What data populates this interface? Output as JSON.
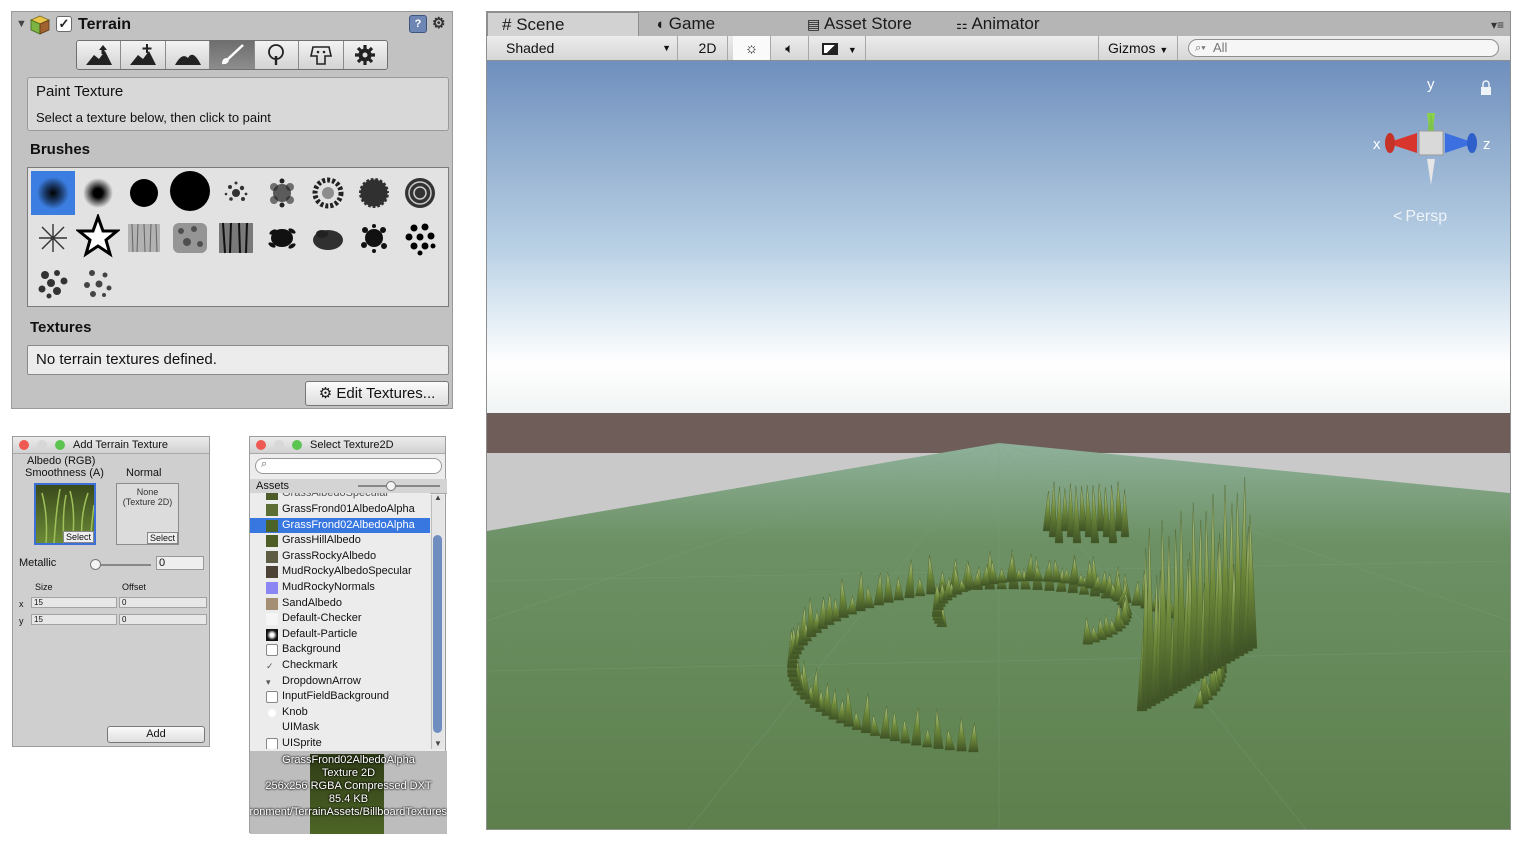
{
  "inspector": {
    "title": "Terrain",
    "enabled": true,
    "tool_icons": [
      "raise-lower-terrain-icon",
      "paint-height-icon",
      "smooth-height-icon",
      "paint-texture-icon",
      "place-trees-icon",
      "paint-details-icon",
      "terrain-settings-icon"
    ],
    "active_tool_index": 3,
    "info_title": "Paint Texture",
    "info_hint": "Select a texture below, then click to paint",
    "brushes_label": "Brushes",
    "brush_count": 20,
    "selected_brush_index": 0,
    "textures_label": "Textures",
    "textures_empty": "No terrain textures defined.",
    "edit_textures_label": "Edit Textures..."
  },
  "add_texture_window": {
    "title": "Add Terrain Texture",
    "albedo_label_1": "Albedo (RGB)",
    "albedo_label_2": "Smoothness (A)",
    "normal_label": "Normal",
    "normal_none_1": "None",
    "normal_none_2": "(Texture 2D)",
    "select_label": "Select",
    "metallic_label": "Metallic",
    "metallic_value": "0",
    "size_label": "Size",
    "offset_label": "Offset",
    "x_label": "x",
    "y_label": "y",
    "size_x": "15",
    "size_y": "15",
    "offset_x": "0",
    "offset_y": "0",
    "add_label": "Add"
  },
  "select_texture_window": {
    "title": "Select Texture2D",
    "assets_tab": "Assets",
    "clipped_item": "GrassAlbedoSpecular",
    "items": [
      {
        "name": "GrassFrond01AlbedoAlpha",
        "swatch": "#5c6e33"
      },
      {
        "name": "GrassFrond02AlbedoAlpha",
        "swatch": "#4d6226",
        "selected": true
      },
      {
        "name": "GrassHillAlbedo",
        "swatch": "#4f5e26"
      },
      {
        "name": "GrassRockyAlbedo",
        "swatch": "#5f5c44"
      },
      {
        "name": "MudRockyAlbedoSpecular",
        "swatch": "#4e4236"
      },
      {
        "name": "MudRockyNormals",
        "swatch": "#8a86f2"
      },
      {
        "name": "SandAlbedo",
        "swatch": "#a58f74"
      },
      {
        "name": "Default-Checker",
        "swatch": "#f5f5f5"
      },
      {
        "name": "Default-Particle",
        "swatch": "#111111"
      },
      {
        "name": "Background",
        "swatch": "box"
      },
      {
        "name": "Checkmark",
        "swatch": "check"
      },
      {
        "name": "DropdownArrow",
        "swatch": "arrow"
      },
      {
        "name": "InputFieldBackground",
        "swatch": "box"
      },
      {
        "name": "Knob",
        "swatch": "circle"
      },
      {
        "name": "UIMask",
        "swatch": "none"
      },
      {
        "name": "UISprite",
        "swatch": "box"
      }
    ],
    "preview_name": "GrassFrond02AlbedoAlpha",
    "preview_type": "Texture 2D",
    "preview_format": "256x256  RGBA Compressed DXT",
    "preview_size": "85.4 KB",
    "preview_path": "Assets/Standard Assets/Environment/TerrainAssets/BillboardTextures"
  },
  "scene_view": {
    "tabs": [
      "Scene",
      "Game",
      "Asset Store",
      "Animator"
    ],
    "active_tab": "Scene",
    "shading_mode": "Shaded",
    "mode_2d": "2D",
    "gizmos_label": "Gizmos",
    "search_value": "All",
    "axis_x": "x",
    "axis_y": "y",
    "axis_z": "z",
    "projection_label": "Persp",
    "colors": {
      "sky_top": "#6f8fbd",
      "horizon": "#ffffff",
      "ground_far": "#6e5d59",
      "grass": "#5d7f4c"
    }
  }
}
